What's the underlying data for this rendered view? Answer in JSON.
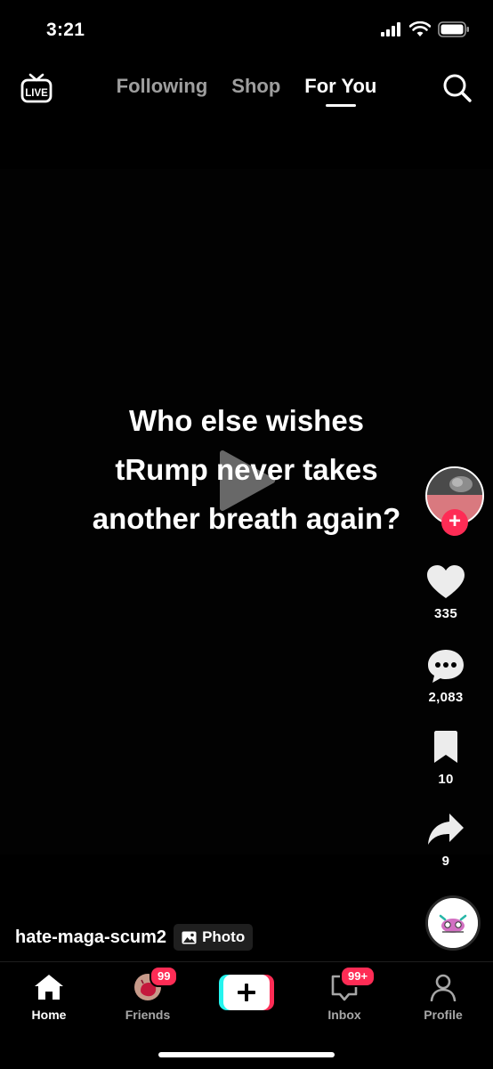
{
  "status_bar": {
    "time": "3:21"
  },
  "top_nav": {
    "live_label": "LIVE",
    "tabs": [
      {
        "label": "Following",
        "active": false
      },
      {
        "label": "Shop",
        "active": false
      },
      {
        "label": "For You",
        "active": true
      }
    ]
  },
  "video": {
    "caption": "Who else wishes tRump never takes another breath again?"
  },
  "actions": {
    "likes": "335",
    "comments": "2,083",
    "saves": "10",
    "shares": "9"
  },
  "author": {
    "username": "hate-maga-scum2",
    "tag_label": "Photo"
  },
  "bottom_nav": {
    "home": "Home",
    "friends": "Friends",
    "friends_badge": "99",
    "inbox": "Inbox",
    "inbox_badge": "99+",
    "profile": "Profile"
  },
  "colors": {
    "accent": "#fe2c55",
    "cyan": "#25f4ee",
    "background": "#000000"
  }
}
